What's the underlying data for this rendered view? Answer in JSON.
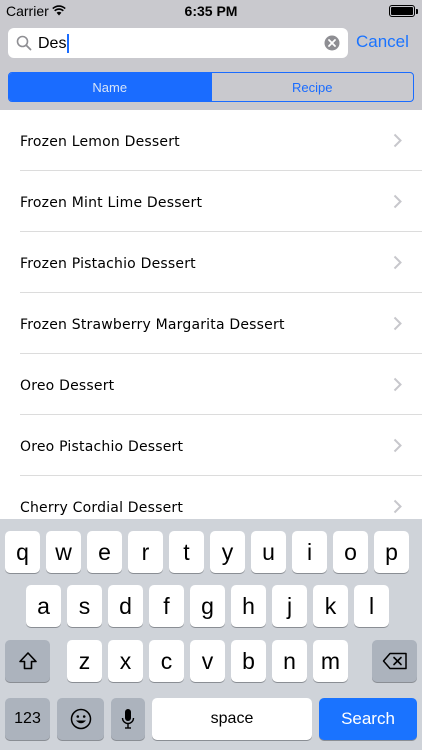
{
  "status_bar": {
    "carrier": "Carrier",
    "time": "6:35 PM"
  },
  "search": {
    "query": "Des",
    "cancel_label": "Cancel",
    "scopes": [
      {
        "label": "Name",
        "selected": true
      },
      {
        "label": "Recipe",
        "selected": false
      }
    ]
  },
  "results": [
    "Frozen Lemon Dessert",
    "Frozen Mint Lime Dessert",
    "Frozen Pistachio Dessert",
    "Frozen Strawberry Margarita Dessert",
    "Oreo Dessert",
    "Oreo Pistachio Dessert",
    "Cherry Cordial Dessert"
  ],
  "keyboard": {
    "row1": [
      "q",
      "w",
      "e",
      "r",
      "t",
      "y",
      "u",
      "i",
      "o",
      "p"
    ],
    "row2": [
      "a",
      "s",
      "d",
      "f",
      "g",
      "h",
      "j",
      "k",
      "l"
    ],
    "row3": [
      "z",
      "x",
      "c",
      "v",
      "b",
      "n",
      "m"
    ],
    "numbers_label": "123",
    "space_label": "space",
    "search_label": "Search"
  },
  "colors": {
    "accent": "#1a73ff",
    "bar_background": "#c9c9ce",
    "keyboard_background": "#cfd3d9"
  },
  "icons": [
    "wifi-icon",
    "battery-icon",
    "search-icon",
    "clear-icon",
    "chevron-right-icon",
    "shift-icon",
    "delete-icon",
    "emoji-icon",
    "microphone-icon"
  ]
}
